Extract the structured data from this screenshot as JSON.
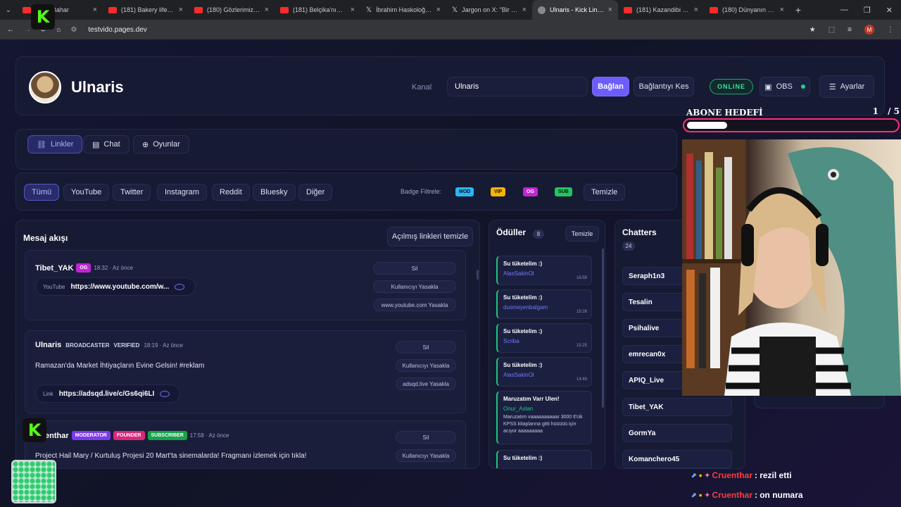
{
  "browser": {
    "tabs": [
      {
        "title": "Mist | Bahar",
        "favicon": "youtube-icon"
      },
      {
        "title": "(181) Bakery life- 24h",
        "favicon": "youtube-icon"
      },
      {
        "title": "(180) Gözlerimiz Nere",
        "favicon": "youtube-icon"
      },
      {
        "title": "(181) Belçika'nın En G",
        "favicon": "youtube-icon"
      },
      {
        "title": "İbrahim Haskoloğlu (",
        "favicon": "x-icon"
      },
      {
        "title": "Jargon on X: \"Bir içer",
        "favicon": "x-icon"
      },
      {
        "title": "Ulnaris - Kick Link Vie",
        "favicon": "globe-icon"
      },
      {
        "title": "(181) Kazandibi Tarifi",
        "favicon": "youtube-icon"
      },
      {
        "title": "(180) Dünyanın En G",
        "favicon": "youtube-icon"
      }
    ],
    "url": "testvido.pages.dev",
    "profile_initial": "M"
  },
  "header": {
    "channel_title": "Ulnaris",
    "kanal_label": "Kanal",
    "kanal_value": "Ulnaris",
    "connect_label": "Bağlan",
    "disconnect_label": "Bağlantıyı Kes",
    "status": "ONLINE",
    "obs_label": "OBS",
    "settings_label": "Ayarlar"
  },
  "nav_tabs": [
    "Linkler",
    "Chat",
    "Oyunlar"
  ],
  "filters": {
    "platforms": [
      "Tümü",
      "YouTube",
      "Twitter",
      "Instagram",
      "Reddit",
      "Bluesky",
      "Diğer"
    ],
    "badge_filter_label": "Badge Filtrele:",
    "badges": [
      {
        "label": "MOD",
        "color": "#29b6f6"
      },
      {
        "label": "VIP",
        "color": "#f5b400"
      },
      {
        "label": "OG",
        "color": "#c026d3"
      },
      {
        "label": "SUB",
        "color": "#22c55e"
      }
    ],
    "clear_label": "Temizle"
  },
  "feed": {
    "title": "Mesaj akışı",
    "clear_opened_label": "Açılmış linkleri temizle",
    "messages": [
      {
        "user": "Tibet_YAK",
        "badges": [
          "OG"
        ],
        "time": "18:32 · Az önce",
        "text": "",
        "link_type": "YouTube",
        "link_url": "https://www.youtube.com/w...",
        "actions": [
          "Sil",
          "Kullanıcıyı Yasakla",
          "www.youtube.com Yasakla"
        ]
      },
      {
        "user": "Ulnaris",
        "badges": [
          "BROADCASTER",
          "VERIFIED"
        ],
        "time": "18:19 · Az önce",
        "text": "Ramazan'da Market İhtiyaçların Evine Gelsin! #reklam",
        "link_type": "Link",
        "link_url": "https://adsqd.live/c/Gs6qi6LI",
        "actions": [
          "Sil",
          "Kullanıcıyı Yasakla",
          "adsqd.live Yasakla"
        ]
      },
      {
        "user": "Cruenthar",
        "user_visible": "enthar",
        "badges": [
          "MODERATOR",
          "FOUNDER",
          "SUBSCRIBER"
        ],
        "time": "17:58 · Az önce",
        "text": "Project Hail Mary / Kurtuluş Projesi 20 Mart'ta sinemalarda! Fragmanı izlemek için tıkla!",
        "actions": [
          "Sil",
          "Kullanıcıyı Yasakla"
        ]
      }
    ]
  },
  "rewards": {
    "title": "Ödüller",
    "count": "8",
    "clear_label": "Temizle",
    "items": [
      {
        "title": "Su tüketelim :)",
        "user": "AlasSakinOl",
        "time": "16:58"
      },
      {
        "title": "Su tüketelim :)",
        "user": "dusmeyenbalgam",
        "time": "15:26"
      },
      {
        "title": "Su tüketelim :)",
        "user": "Scriba",
        "time": "15:25"
      },
      {
        "title": "Su tüketelim :)",
        "user": "AlasSakinOl",
        "time": "14:49"
      },
      {
        "title": "Maruzatım Varr Ulen!",
        "user": "Onur_Aslan",
        "text": "Maruzatım vaaaaaaaaaar 3000 tl'cik KPSS kitaplarına gitti hüüüüü için acıyor aaaaaaaaa",
        "time": ""
      },
      {
        "title": "Su tüketelim :)",
        "user": "",
        "time": ""
      }
    ]
  },
  "chatters": {
    "title": "Chatters",
    "count": "24",
    "names": [
      "Seraph1n3",
      "Tesalin",
      "Psihalive",
      "emrecan0x",
      "APIQ_Live",
      "Tibet_YAK",
      "GormYa",
      "Komanchero45"
    ]
  },
  "overlay": {
    "goal_title": "ABONE HEDEFİ",
    "goal_current": "1",
    "goal_target": "/ 5",
    "goal_progress": 0.2,
    "chat": [
      {
        "user": "Cruenthar",
        "text": ": rezil etti"
      },
      {
        "user": "Cruenthar",
        "text": ": on numara"
      }
    ]
  },
  "colors": {
    "accent": "#6d5dfc",
    "online": "#22d67e",
    "goal_border": "#ff2e78",
    "chat_user": "#ff3b3b"
  }
}
